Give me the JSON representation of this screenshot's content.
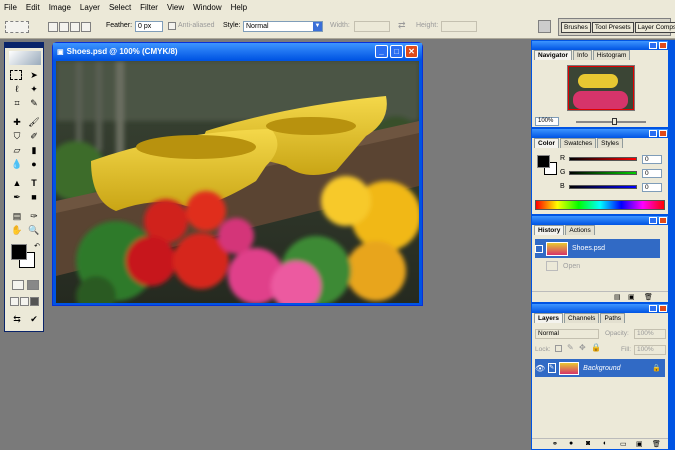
{
  "menu": [
    "File",
    "Edit",
    "Image",
    "Layer",
    "Select",
    "Filter",
    "View",
    "Window",
    "Help"
  ],
  "options": {
    "feather_label": "Feather:",
    "feather_value": "0 px",
    "antialiased_label": "Anti-aliased",
    "style_label": "Style:",
    "style_value": "Normal",
    "width_label": "Width:",
    "height_label": "Height:"
  },
  "palette_well": [
    "Brushes",
    "Tool Presets",
    "Layer Comps"
  ],
  "document": {
    "title": "Shoes.psd @ 100% (CMYK/8)"
  },
  "navigator": {
    "tabs": [
      "Navigator",
      "Info",
      "Histogram"
    ],
    "zoom": "100%"
  },
  "color": {
    "tabs": [
      "Color",
      "Swatches",
      "Styles"
    ],
    "channels": [
      {
        "name": "R",
        "value": "0",
        "color": "#d40000"
      },
      {
        "name": "G",
        "value": "0",
        "color": "#00a000"
      },
      {
        "name": "B",
        "value": "0",
        "color": "#0000d0"
      }
    ]
  },
  "history": {
    "tabs": [
      "History",
      "Actions"
    ],
    "items": [
      {
        "label": "Shoes.psd"
      },
      {
        "label": "Open"
      }
    ]
  },
  "layers": {
    "tabs": [
      "Layers",
      "Channels",
      "Paths"
    ],
    "blend_mode": "Normal",
    "opacity_label": "Opacity:",
    "opacity_value": "100%",
    "lock_label": "Lock:",
    "fill_label": "Fill:",
    "fill_value": "100%",
    "items": [
      {
        "name": "Background"
      }
    ]
  },
  "colors": {
    "accent": "#0054e3",
    "selected": "#316ac5",
    "chrome": "#ece9d8",
    "workspace": "#7a7a7a"
  }
}
